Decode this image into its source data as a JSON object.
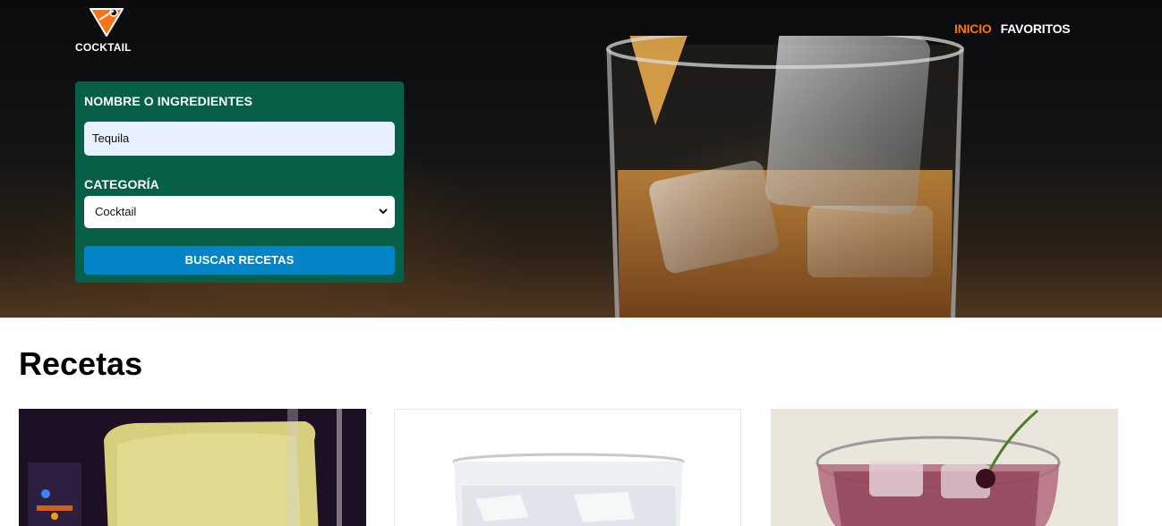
{
  "brand": {
    "logo_text": "COCKTAIL",
    "accent": "#f97316"
  },
  "nav": {
    "items": [
      {
        "label": "INICIO",
        "active": true
      },
      {
        "label": "FAVORITOS",
        "active": false
      }
    ]
  },
  "search_form": {
    "name_label": "NOMBRE O INGREDIENTES",
    "name_value": "Tequila",
    "category_label": "CATEGORÍA",
    "category_selected": "Cocktail",
    "submit_label": "BUSCAR RECETAS",
    "panel_color": "#065f46",
    "button_color": "#0284c7"
  },
  "recipes": {
    "title": "Recetas",
    "cards": [
      {
        "image": "yellow-cocktail-photo"
      },
      {
        "image": "clear-drink-photo"
      },
      {
        "image": "red-cocktail-cherry-photo"
      }
    ]
  }
}
